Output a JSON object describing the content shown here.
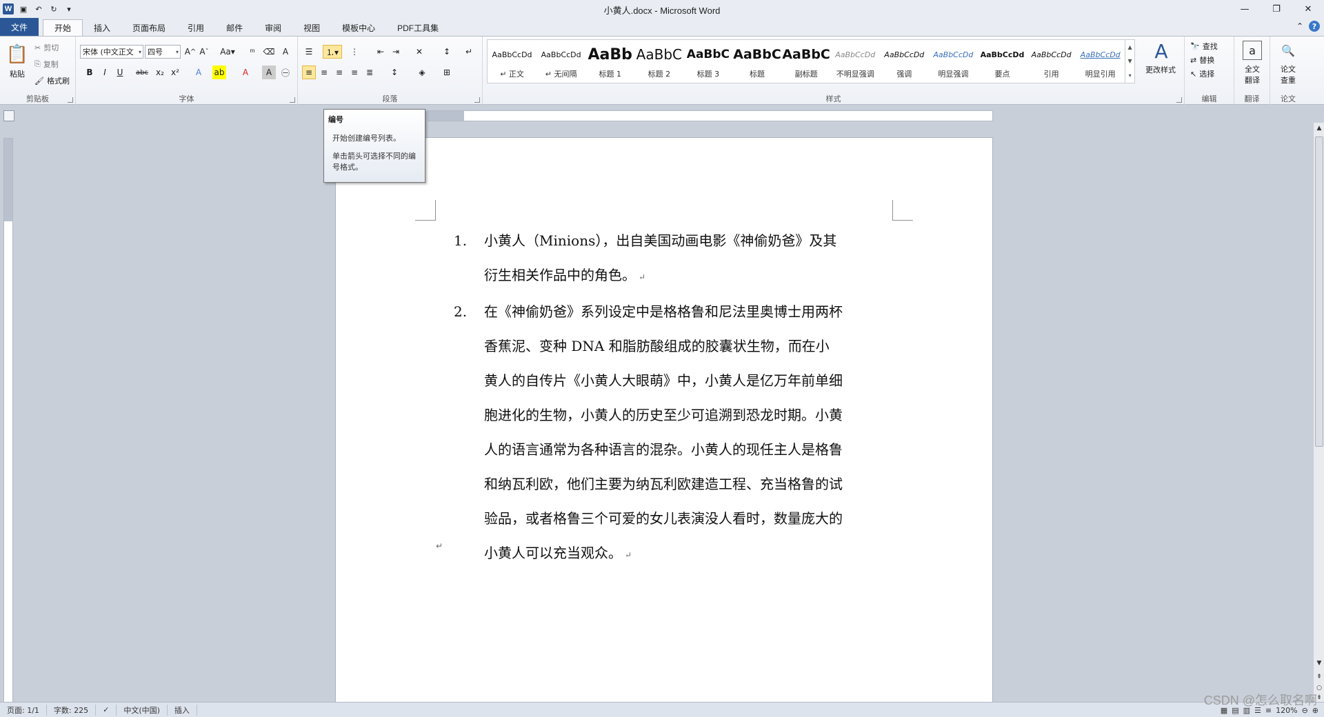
{
  "window": {
    "title": "小黄人.docx - Microsoft Word",
    "minimize": "—",
    "restore": "❐",
    "close": "✕"
  },
  "tabs": [
    {
      "label": "文件"
    },
    {
      "label": "开始"
    },
    {
      "label": "插入"
    },
    {
      "label": "页面布局"
    },
    {
      "label": "引用"
    },
    {
      "label": "邮件"
    },
    {
      "label": "审阅"
    },
    {
      "label": "视图"
    },
    {
      "label": "模板中心"
    },
    {
      "label": "PDF工具集"
    }
  ],
  "ribbon": {
    "clipboard": {
      "label": "剪贴板",
      "paste": "粘贴",
      "cut": "剪切",
      "copy": "复制",
      "format_painter": "格式刷"
    },
    "font": {
      "label": "字体",
      "font_name": "宋体 (中文正文",
      "font_size": "四号"
    },
    "paragraph": {
      "label": "段落"
    },
    "styles": {
      "label": "样式",
      "change_styles": "更改样式",
      "items": [
        {
          "sample": "AaBbCcDd",
          "name": "↵ 正文"
        },
        {
          "sample": "AaBbCcDd",
          "name": "↵ 无间隔"
        },
        {
          "sample": "AaBb",
          "name": "标题 1"
        },
        {
          "sample": "AaBbC",
          "name": "标题 2"
        },
        {
          "sample": "AaBbC",
          "name": "标题 3"
        },
        {
          "sample": "AaBbC",
          "name": "标题"
        },
        {
          "sample": "AaBbC",
          "name": "副标题"
        },
        {
          "sample": "AaBbCcDd",
          "name": "不明显强调"
        },
        {
          "sample": "AaBbCcDd",
          "name": "强调"
        },
        {
          "sample": "AaBbCcDd",
          "name": "明显强调"
        },
        {
          "sample": "AaBbCcDd",
          "name": "要点"
        },
        {
          "sample": "AaBbCcDd",
          "name": "引用"
        },
        {
          "sample": "AaBbCcDd",
          "name": "明显引用"
        }
      ]
    },
    "editing": {
      "label": "编辑",
      "find": "查找",
      "replace": "替换",
      "select": "选择"
    },
    "translate": {
      "label": "翻译",
      "full_text": "全文",
      "translate": "翻译"
    },
    "paper": {
      "label": "论文",
      "paper": "论文",
      "check": "查重"
    }
  },
  "tooltip": {
    "title": "编号",
    "line1": "开始创建编号列表。",
    "line2": "单击箭头可选择不同的编号格式。"
  },
  "document": {
    "items": [
      {
        "num": "1.",
        "text": "小黄人（Minions），出自美国动画电影《神偷奶爸》及其衍生相关作品中的角色。"
      },
      {
        "num": "2.",
        "text": "在《神偷奶爸》系列设定中是格格鲁和尼法里奥博士用两杯香蕉泥、变种 DNA 和脂肪酸组成的胶囊状生物，而在小黄人的自传片《小黄人大眼萌》中，小黄人是亿万年前单细胞进化的生物，小黄人的历史至少可追溯到恐龙时期。小黄人的语言通常为各种语言的混杂。小黄人的现任主人是格鲁和纳瓦利欧，他们主要为纳瓦利欧建造工程、充当格鲁的试验品，或者格鲁三个可爱的女儿表演没人看时，数量庞大的小黄人可以充当观众。"
      }
    ],
    "para_mark": "↵"
  },
  "status": {
    "page": "页面: 1/1",
    "words": "字数: 225",
    "language": "中文(中国)",
    "mode": "插入",
    "zoom": "120%"
  },
  "watermark": "CSDN @怎么取名啊",
  "colors": {
    "accent": "#2b5797",
    "selected_button": "#fde79c"
  }
}
